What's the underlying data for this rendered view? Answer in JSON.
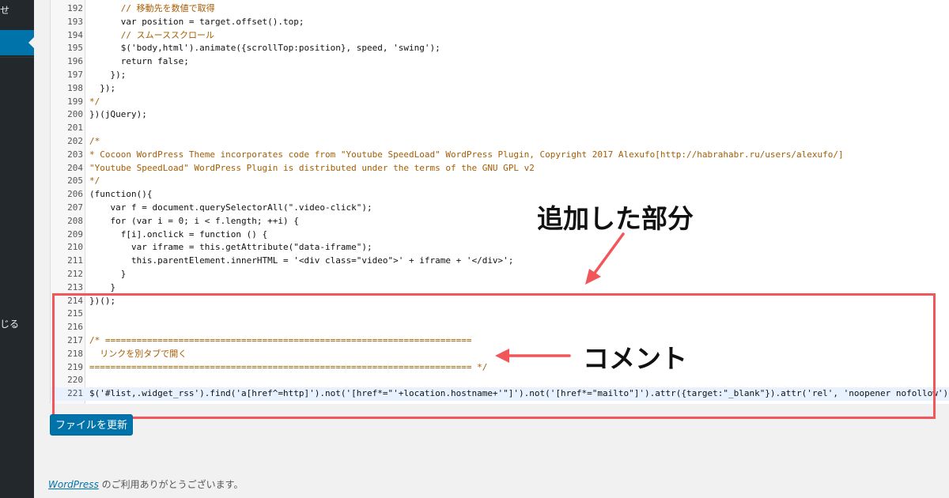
{
  "sidebar": {
    "top_text": "せ",
    "mid_text": "じる"
  },
  "editor": {
    "lines": [
      {
        "n": "192",
        "code": "      // 移動先を数値で取得",
        "cls": "cm"
      },
      {
        "n": "193",
        "code": "      var position = target.offset().top;",
        "cls": ""
      },
      {
        "n": "194",
        "code": "      // スムーススクロール",
        "cls": "cm"
      },
      {
        "n": "195",
        "code": "      $('body,html').animate({scrollTop:position}, speed, 'swing');",
        "cls": ""
      },
      {
        "n": "196",
        "code": "      return false;",
        "cls": ""
      },
      {
        "n": "197",
        "code": "    });",
        "cls": ""
      },
      {
        "n": "198",
        "code": "  });",
        "cls": ""
      },
      {
        "n": "199",
        "code": "*/",
        "cls": "cm"
      },
      {
        "n": "200",
        "code": "})(jQuery);",
        "cls": ""
      },
      {
        "n": "201",
        "code": "",
        "cls": ""
      },
      {
        "n": "202",
        "code": "/*",
        "cls": "cm"
      },
      {
        "n": "203",
        "code": "* Cocoon WordPress Theme incorporates code from \"Youtube SpeedLoad\" WordPress Plugin, Copyright 2017 Alexufo[http://habrahabr.ru/users/alexufo/]",
        "cls": "cm"
      },
      {
        "n": "204",
        "code": "\"Youtube SpeedLoad\" WordPress Plugin is distributed under the terms of the GNU GPL v2",
        "cls": "cm"
      },
      {
        "n": "205",
        "code": "*/",
        "cls": "cm"
      },
      {
        "n": "206",
        "code": "(function(){",
        "cls": ""
      },
      {
        "n": "207",
        "code": "    var f = document.querySelectorAll(\".video-click\");",
        "cls": ""
      },
      {
        "n": "208",
        "code": "    for (var i = 0; i < f.length; ++i) {",
        "cls": ""
      },
      {
        "n": "209",
        "code": "      f[i].onclick = function () {",
        "cls": ""
      },
      {
        "n": "210",
        "code": "        var iframe = this.getAttribute(\"data-iframe\");",
        "cls": ""
      },
      {
        "n": "211",
        "code": "        this.parentElement.innerHTML = '<div class=\"video\">' + iframe + '</div>';",
        "cls": ""
      },
      {
        "n": "212",
        "code": "      }",
        "cls": ""
      },
      {
        "n": "213",
        "code": "    }",
        "cls": ""
      },
      {
        "n": "214",
        "code": "})();",
        "cls": ""
      },
      {
        "n": "215",
        "code": "",
        "cls": ""
      },
      {
        "n": "216",
        "code": "",
        "cls": ""
      },
      {
        "n": "217",
        "code": "/* ======================================================================",
        "cls": "cm"
      },
      {
        "n": "218",
        "code": "  リンクを別タブで開く",
        "cls": "cm"
      },
      {
        "n": "219",
        "code": "========================================================================= */",
        "cls": "cm"
      },
      {
        "n": "220",
        "code": "",
        "cls": ""
      },
      {
        "n": "221",
        "code": "$('#list,.widget_rss').find('a[href^=http]').not('[href*=\"'+location.hostname+'\"]').not('[href*=\"mailto\"]').attr({target:\"_blank\"}).attr('rel', 'noopener nofollow');",
        "cls": "",
        "active": true
      }
    ]
  },
  "annotations": {
    "added_label": "追加した部分",
    "comment_label": "コメント",
    "arrow_color": "#f0565a"
  },
  "update_button": {
    "label": "ファイルを更新"
  },
  "footer": {
    "link_text": "WordPress",
    "text": " のご利用ありがとうございます。"
  }
}
